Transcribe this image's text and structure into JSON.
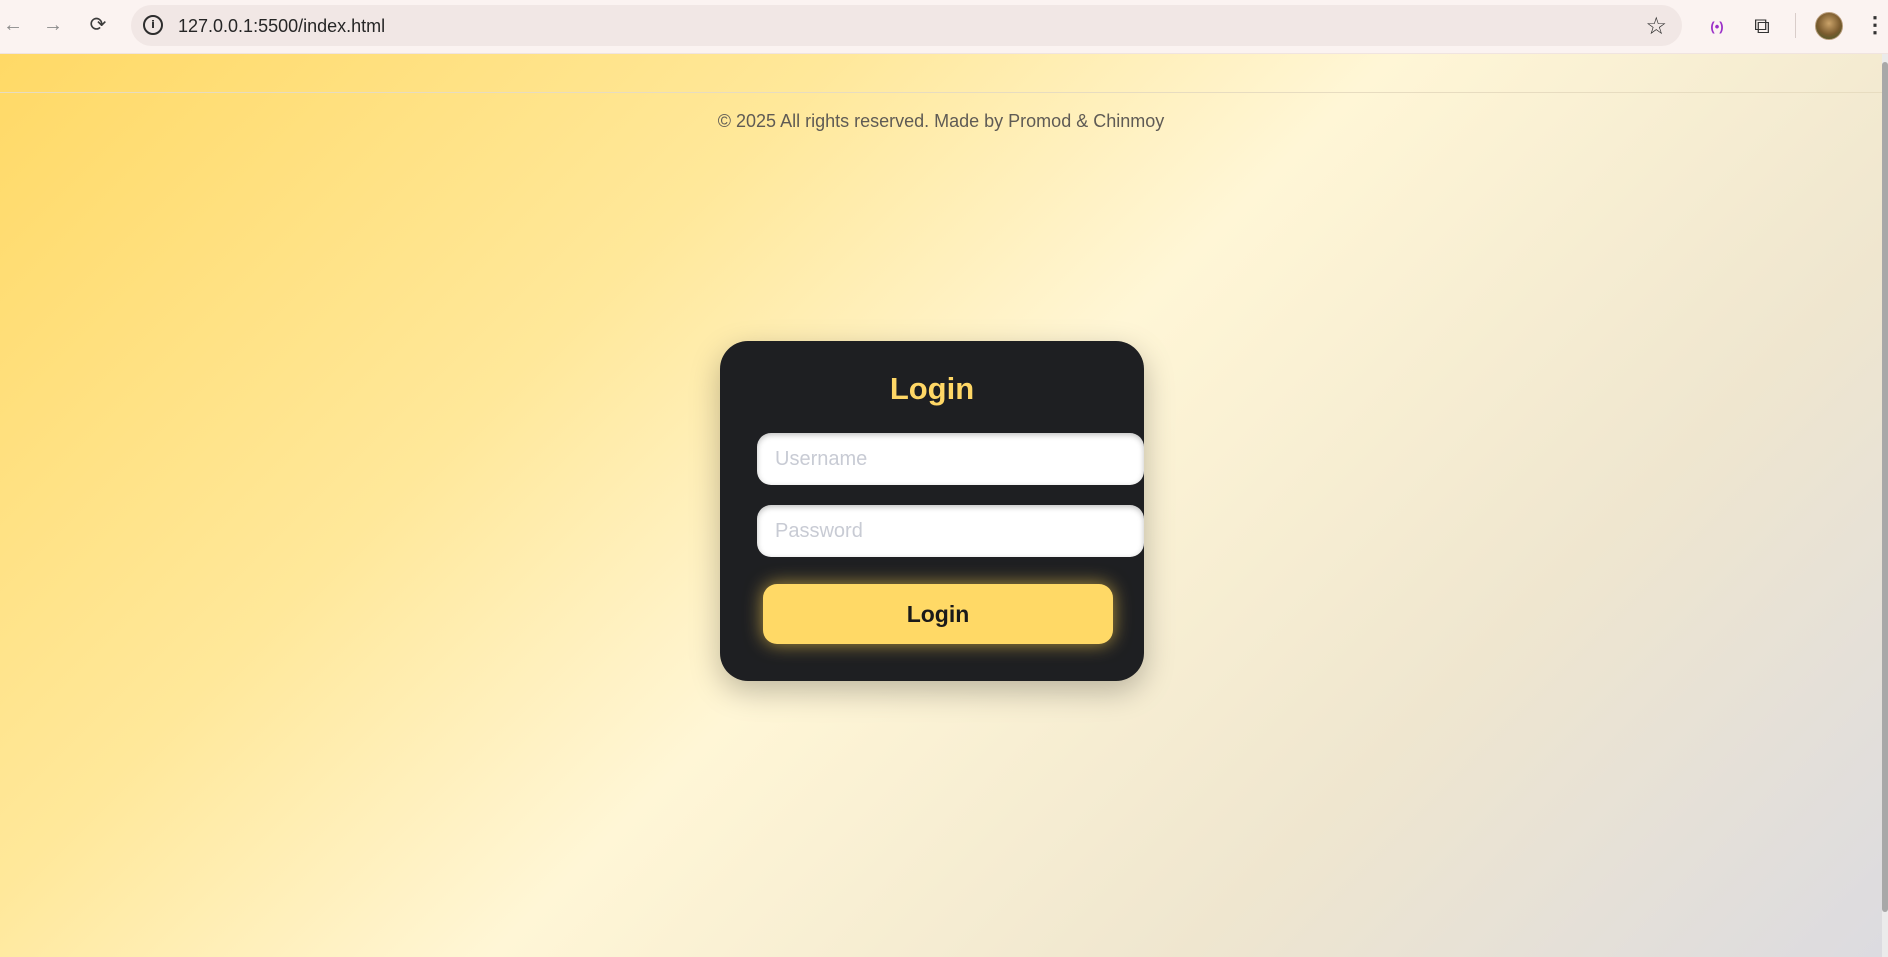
{
  "browser": {
    "url": "127.0.0.1:5500/index.html",
    "back_icon": "←",
    "forward_icon": "→",
    "reload_icon": "⟳",
    "info_icon": "i",
    "star_icon": "☆",
    "cast_icon": "(•)",
    "extensions_icon": "⧉",
    "menu_icon": "⋮"
  },
  "footer": {
    "text": "© 2025 All rights reserved. Made by Promod & Chinmoy"
  },
  "login_card": {
    "title": "Login",
    "username_placeholder": "Username",
    "password_placeholder": "Password",
    "button_label": "Login"
  },
  "colors": {
    "accent": "#ffd966",
    "card_bg": "#1e1f22"
  }
}
